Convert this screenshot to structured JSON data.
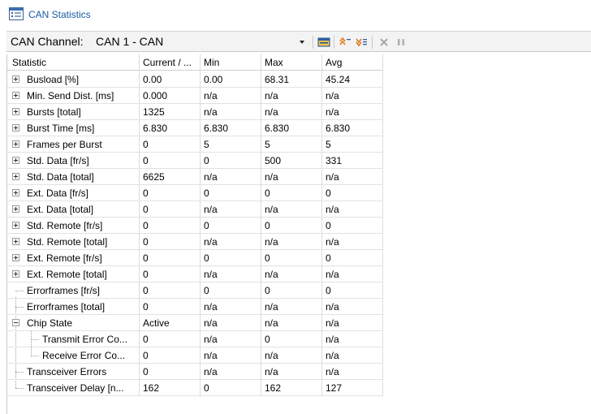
{
  "window": {
    "title": "CAN Statistics"
  },
  "toolbar": {
    "channel_label": "CAN Channel:",
    "channel_value": "CAN 1 - CAN"
  },
  "columns": [
    "Statistic",
    "Current / ...",
    "Min",
    "Max",
    "Avg"
  ],
  "rows": [
    {
      "statistic": "Busload [%]",
      "current": "0.00",
      "min": "0.00",
      "max": "68.31",
      "avg": "45.24"
    },
    {
      "statistic": "Min. Send Dist. [ms]",
      "current": "0.000",
      "min": "n/a",
      "max": "n/a",
      "avg": "n/a"
    },
    {
      "statistic": "Bursts [total]",
      "current": "1325",
      "min": "n/a",
      "max": "n/a",
      "avg": "n/a"
    },
    {
      "statistic": "Burst Time [ms]",
      "current": "6.830",
      "min": "6.830",
      "max": "6.830",
      "avg": "6.830"
    },
    {
      "statistic": "Frames per Burst",
      "current": "0",
      "min": "5",
      "max": "5",
      "avg": "5"
    },
    {
      "statistic": "Std. Data [fr/s]",
      "current": "0",
      "min": "0",
      "max": "500",
      "avg": "331"
    },
    {
      "statistic": "Std. Data [total]",
      "current": "6625",
      "min": "n/a",
      "max": "n/a",
      "avg": "n/a"
    },
    {
      "statistic": "Ext. Data [fr/s]",
      "current": "0",
      "min": "0",
      "max": "0",
      "avg": "0"
    },
    {
      "statistic": "Ext. Data [total]",
      "current": "0",
      "min": "n/a",
      "max": "n/a",
      "avg": "n/a"
    },
    {
      "statistic": "Std. Remote [fr/s]",
      "current": "0",
      "min": "0",
      "max": "0",
      "avg": "0"
    },
    {
      "statistic": "Std. Remote [total]",
      "current": "0",
      "min": "n/a",
      "max": "n/a",
      "avg": "n/a"
    },
    {
      "statistic": "Ext. Remote [fr/s]",
      "current": "0",
      "min": "0",
      "max": "0",
      "avg": "0"
    },
    {
      "statistic": "Ext. Remote [total]",
      "current": "0",
      "min": "n/a",
      "max": "n/a",
      "avg": "n/a"
    },
    {
      "statistic": "Errorframes [fr/s]",
      "current": "0",
      "min": "0",
      "max": "0",
      "avg": "0"
    },
    {
      "statistic": "Errorframes [total]",
      "current": "0",
      "min": "n/a",
      "max": "n/a",
      "avg": "n/a"
    },
    {
      "statistic": "Chip State",
      "current": "Active",
      "min": "n/a",
      "max": "n/a",
      "avg": "n/a"
    },
    {
      "statistic": "Transmit Error Co...",
      "current": "0",
      "min": "n/a",
      "max": "0",
      "avg": "n/a"
    },
    {
      "statistic": "Receive Error Co...",
      "current": "0",
      "min": "n/a",
      "max": "n/a",
      "avg": "n/a"
    },
    {
      "statistic": "Transceiver Errors",
      "current": "0",
      "min": "n/a",
      "max": "n/a",
      "avg": "n/a"
    },
    {
      "statistic": "Transceiver Delay [n...",
      "current": "162",
      "min": "0",
      "max": "162",
      "avg": "127"
    }
  ],
  "colors": {
    "title_text": "#1a5aa6",
    "toolbar_bg": "#f3f3f3",
    "grid_line": "#e2e2e2"
  },
  "icons": [
    "channel-window-icon",
    "open-folder-icon",
    "sort-ascending-icon",
    "sort-descending-icon",
    "clear-icon",
    "pause-icon"
  ]
}
